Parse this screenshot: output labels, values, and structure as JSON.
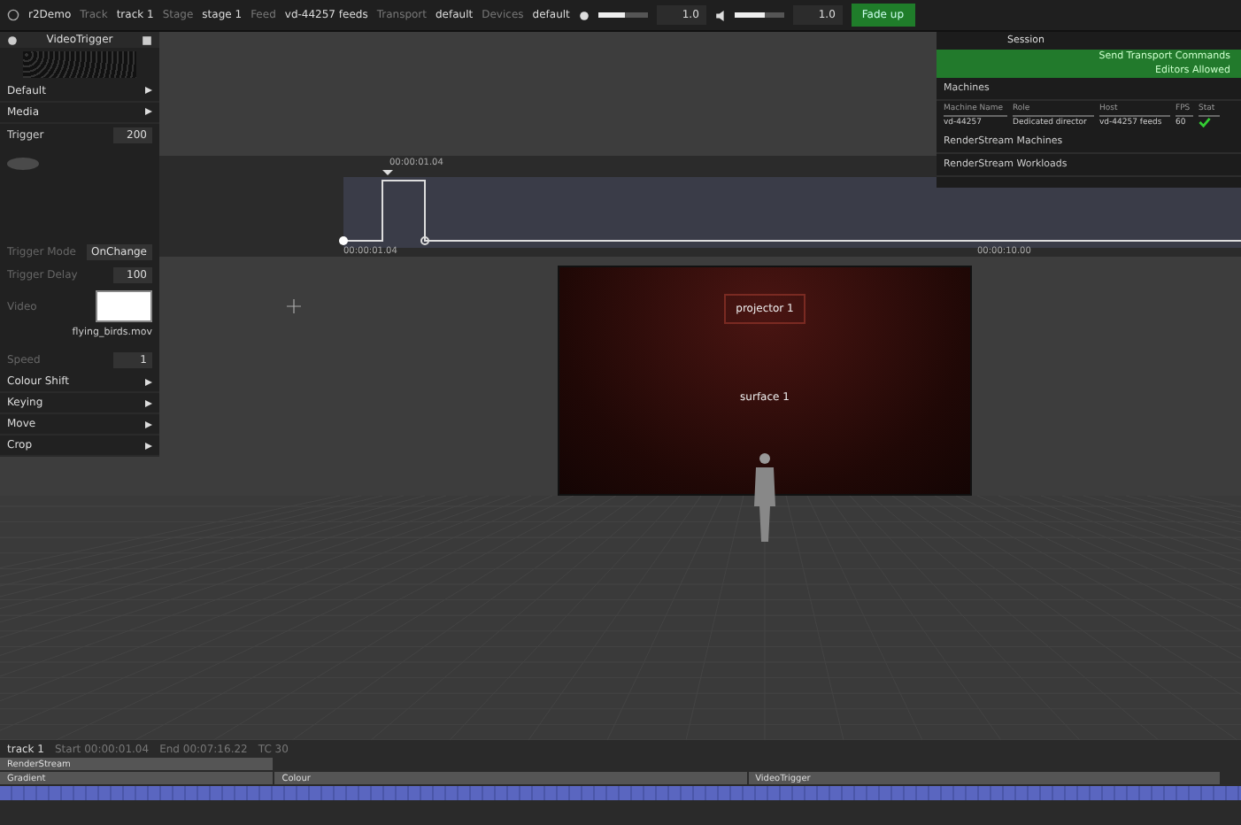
{
  "toolbar": {
    "project": "r2Demo",
    "fields": [
      {
        "label": "Track",
        "value": "track 1"
      },
      {
        "label": "Stage",
        "value": "stage 1"
      },
      {
        "label": "Feed",
        "value": "vd-44257 feeds"
      },
      {
        "label": "Transport",
        "value": "default"
      },
      {
        "label": "Devices",
        "value": "default"
      }
    ],
    "sliders": [
      {
        "level": 0.55,
        "reading": "1.0"
      },
      {
        "level": 0.6,
        "reading": "1.0"
      }
    ],
    "action": "Fade up"
  },
  "left_panel": {
    "title": "VideoTrigger",
    "sections": [
      {
        "label": "Default"
      },
      {
        "label": "Media"
      }
    ],
    "trigger": {
      "label": "Trigger",
      "value": "200"
    },
    "properties": [
      {
        "label": "Trigger Mode",
        "value": "OnChange"
      },
      {
        "label": "Trigger Delay",
        "value": "100"
      }
    ],
    "video_label": "Video",
    "video_file": "flying_birds.mov",
    "speed": {
      "label": "Speed",
      "value": "1"
    },
    "more_sections": [
      {
        "label": "Colour Shift"
      },
      {
        "label": "Keying"
      },
      {
        "label": "Move"
      },
      {
        "label": "Crop"
      }
    ]
  },
  "session": {
    "title": "Session",
    "options": [
      "Send Transport Commands",
      "Editors Allowed"
    ],
    "machines_title": "Machines",
    "columns": [
      "Machine Name",
      "Role",
      "Host",
      "FPS",
      "Stat"
    ],
    "rows": [
      {
        "cells": [
          "vd-44257",
          "Dedicated director",
          "vd-44257 feeds",
          "60"
        ],
        "ok": true
      }
    ],
    "groups": [
      "RenderStream Machines",
      "RenderStream Workloads"
    ]
  },
  "keyframes": {
    "marker": "00:00:01.04",
    "start": "00:00:01.04",
    "end": "00:00:10.00"
  },
  "stage": {
    "labels": [
      "projector 1",
      "surface 1"
    ]
  },
  "bottom": {
    "track": "track 1",
    "start": "Start 00:00:01.04",
    "end": "End 00:07:16.22",
    "tc": "TC 30",
    "layers": [
      {
        "name": "RenderStream"
      },
      {
        "name": "Gradient"
      },
      {
        "name": "Colour"
      },
      {
        "name": "VideoTrigger"
      }
    ]
  }
}
